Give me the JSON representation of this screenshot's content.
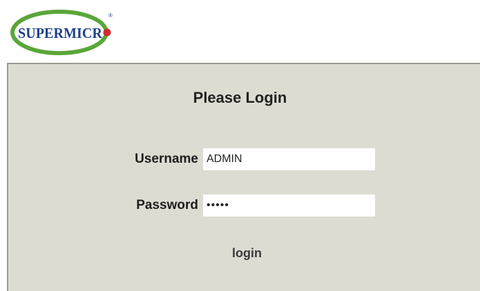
{
  "header": {
    "logo_text": "SUPERMICR",
    "logo_reg_mark": "®",
    "brand_colors": {
      "ring": "#5aa63a",
      "text": "#1f3f8a",
      "dot": "#d42a2a"
    }
  },
  "login": {
    "title": "Please Login",
    "username_label": "Username",
    "username_value": "ADMIN",
    "password_label": "Password",
    "password_value": "•••••",
    "submit_label": "login"
  },
  "colors": {
    "panel_background": "#dcdcd2",
    "panel_border": "#9b9b93"
  }
}
